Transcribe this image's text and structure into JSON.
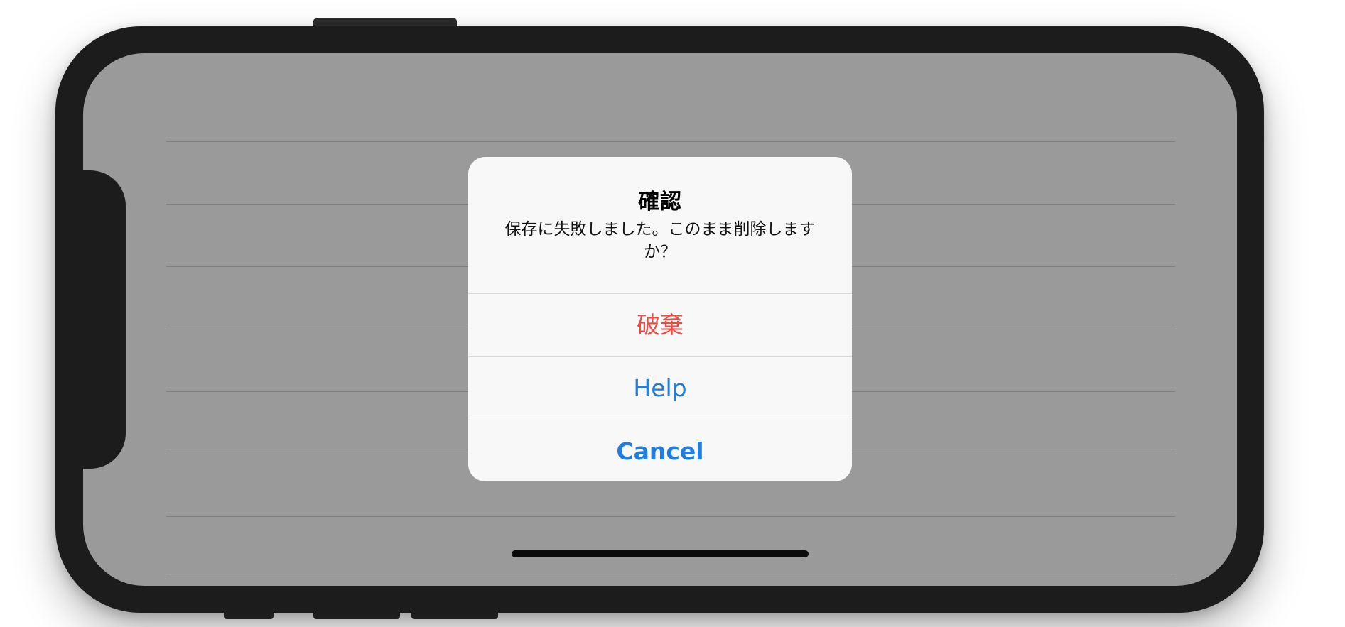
{
  "alert": {
    "title": "確認",
    "message": "保存に失敗しました。このまま削除しますか？",
    "actions": {
      "destructive": "破棄",
      "help": "Help",
      "cancel": "Cancel"
    }
  },
  "colors": {
    "destructive": "#ee4a41",
    "accent": "#1f7ee0",
    "dimmed_background": "#9a9a9a",
    "device_frame": "#1c1c1c",
    "alert_background": "#f8f8f8"
  }
}
